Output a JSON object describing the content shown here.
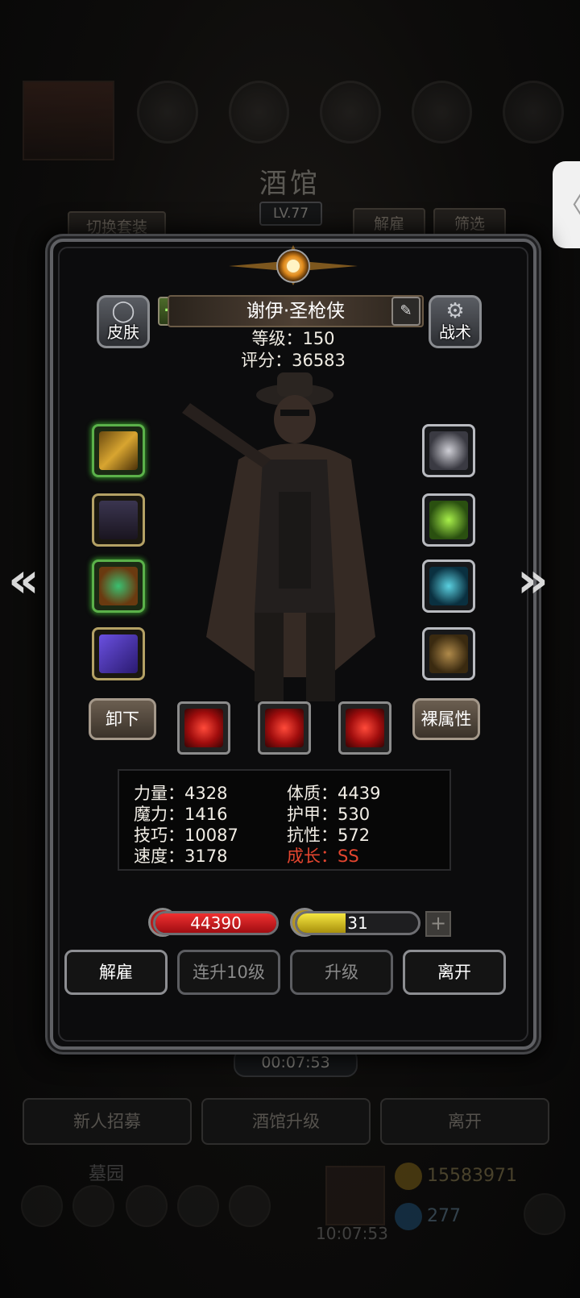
{
  "background": {
    "title": "酒馆",
    "level": "LV.77",
    "switch_outfit": "切换套装",
    "dismiss": "解雇",
    "filter": "筛选",
    "timer": "00:07:53",
    "recruit": "新人招募",
    "upgrade_tavern": "酒馆升级",
    "leave": "离开",
    "graveyard": "墓园",
    "gold": "15583971",
    "gems": "277",
    "bottom_timer": "10:07:53"
  },
  "hero": {
    "name": "谢伊·圣枪侠",
    "level_text": "等级：150",
    "score_text": "评分：36583",
    "skin_label": "皮肤",
    "tactics_label": "战术"
  },
  "equipment_left": [
    "golden-gun-icon",
    "coat-armor-icon",
    "emerald-amulet-icon",
    "purple-tome-icon"
  ],
  "equipment_right": [
    "cloud-charm-icon",
    "green-crystal-icon",
    "blue-gem-icon",
    "bronze-bell-icon"
  ],
  "controls": {
    "unequip": "卸下",
    "base_stats": "裸属性"
  },
  "stats": {
    "strength": "力量：4328",
    "magic": "魔力：1416",
    "skill": "技巧：10087",
    "speed": "速度：3178",
    "constitution": "体质：4439",
    "armor": "护甲：530",
    "resist": "抗性：572",
    "growth": "成长：SS"
  },
  "bars": {
    "hp": "44390",
    "energy": "31",
    "energy_fill": 0.4
  },
  "actions": {
    "dismiss": "解雇",
    "level10": "连升10级",
    "upgrade": "升级",
    "leave": "离开"
  },
  "colors": {
    "growth": "#e3452f",
    "hp": "#d8181e",
    "energy": "#d8c21a"
  }
}
